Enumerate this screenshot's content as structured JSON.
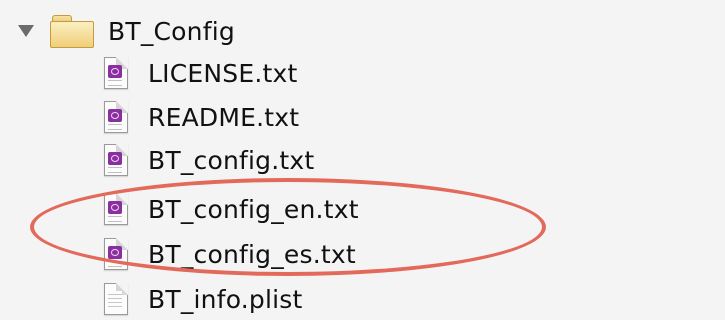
{
  "folder": {
    "name": "BT_Config",
    "icon": "folder-icon",
    "expanded": true
  },
  "files": [
    {
      "name": "LICENSE.txt",
      "icon": "text-document-icon"
    },
    {
      "name": "README.txt",
      "icon": "text-document-icon"
    },
    {
      "name": "BT_config.txt",
      "icon": "text-document-icon"
    },
    {
      "name": "BT_config_en.txt",
      "icon": "text-document-icon"
    },
    {
      "name": "BT_config_es.txt",
      "icon": "text-document-icon"
    },
    {
      "name": "BT_info.plist",
      "icon": "plist-document-icon"
    }
  ],
  "highlight": {
    "color": "#e36a5a",
    "shape": "ellipse"
  }
}
